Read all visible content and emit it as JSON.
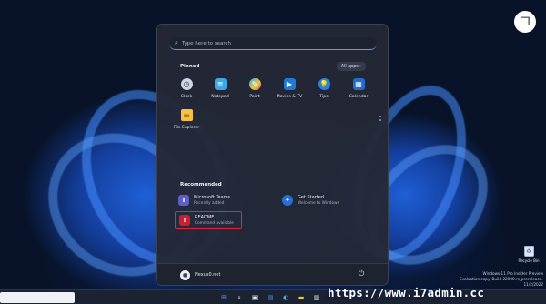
{
  "start_menu": {
    "search_placeholder": "Type here to search",
    "pinned_title": "Pinned",
    "all_apps_label": "All apps  ›",
    "pinned_apps": [
      {
        "label": "Clock",
        "icon": "clock-icon",
        "color": "#9aa4b5"
      },
      {
        "label": "Notepad",
        "icon": "notepad-icon",
        "color": "#3aa7e8"
      },
      {
        "label": "Paint",
        "icon": "paint-icon",
        "color": "#35b6e6"
      },
      {
        "label": "Movies & TV",
        "icon": "movies-tv-icon",
        "color": "#1f7ad6"
      },
      {
        "label": "Tips",
        "icon": "tips-icon",
        "color": "#2a84e6"
      },
      {
        "label": "Calendar",
        "icon": "calendar-icon",
        "color": "#1f6fd2"
      },
      {
        "label": "File Explorer",
        "icon": "folder-icon",
        "color": "#f5c242"
      }
    ],
    "recommended_title": "Recommended",
    "recommended": [
      {
        "name": "Microsoft Teams",
        "sub": "Recently added",
        "icon": "teams-icon",
        "color": "#5b5fc7"
      },
      {
        "name": "Get Started",
        "sub": "Welcome to Windows",
        "icon": "get-started-icon",
        "color": "#2a6fd0"
      },
      {
        "name": "README",
        "sub": "Command available",
        "icon": "readme-icon",
        "color": "#c8202e"
      }
    ],
    "user_name": "Nexus0.net"
  },
  "desktop": {
    "recycle_bin_label": "Recycle Bin",
    "build_lines": [
      "Windows 11 Pro Insider Preview",
      "Evaluation copy. Build 22000.rs_prerelease.210714-1400",
      "11/2/2022"
    ],
    "watermark": "https://www.i7admin.cc"
  },
  "taskbar": {
    "icons": [
      "windows-start-icon",
      "search-icon",
      "task-view-icon",
      "widgets-icon",
      "edge-icon",
      "file-explorer-icon",
      "store-icon"
    ]
  },
  "colors": {
    "accent": "#4aa3ff",
    "highlight_border": "#e2253a"
  }
}
